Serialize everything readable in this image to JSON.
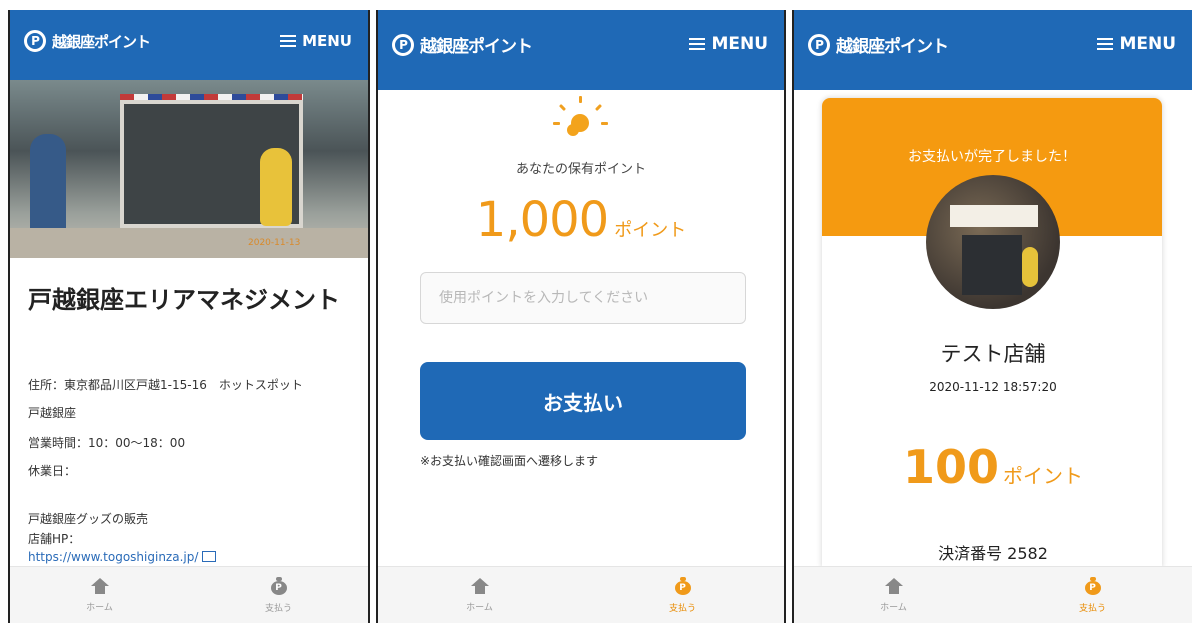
{
  "app": {
    "logo_text": "越銀座ポイント",
    "logo_mark": "P",
    "menu_label": "MENU"
  },
  "nav": {
    "home_label": "ホーム",
    "pay_label": "支払う"
  },
  "screen1": {
    "photo_stamp": "2020-11-13",
    "shop_title": "戸越銀座エリアマネジメント",
    "address_line1": "住所：東京都品川区戸越1-15-16　ホットスポット",
    "address_line2": "戸越銀座",
    "hours": "営業時間：10：00〜18：00",
    "closed": "休業日：",
    "desc": "戸越銀座グッズの販売",
    "hp_label": "店舗HP：",
    "hp_url": "https://www.togoshiginza.jp/"
  },
  "screen2": {
    "points_caption": "あなたの保有ポイント",
    "points_value": "1,000",
    "points_unit": "ポイント",
    "input_placeholder": "使用ポイントを入力してください",
    "pay_button": "お支払い",
    "note": "※お支払い確認画面へ遷移します"
  },
  "screen3": {
    "complete_message": "お支払いが完了しました！",
    "shop_name": "テスト店舗",
    "datetime": "2020-11-12 18:57:20",
    "points_value": "100",
    "points_unit": "ポイント",
    "transaction": "決済番号 2582"
  },
  "colors": {
    "header": "#1f69b6",
    "accent": "#f09a1a",
    "complete_banner": "#f59a10"
  }
}
